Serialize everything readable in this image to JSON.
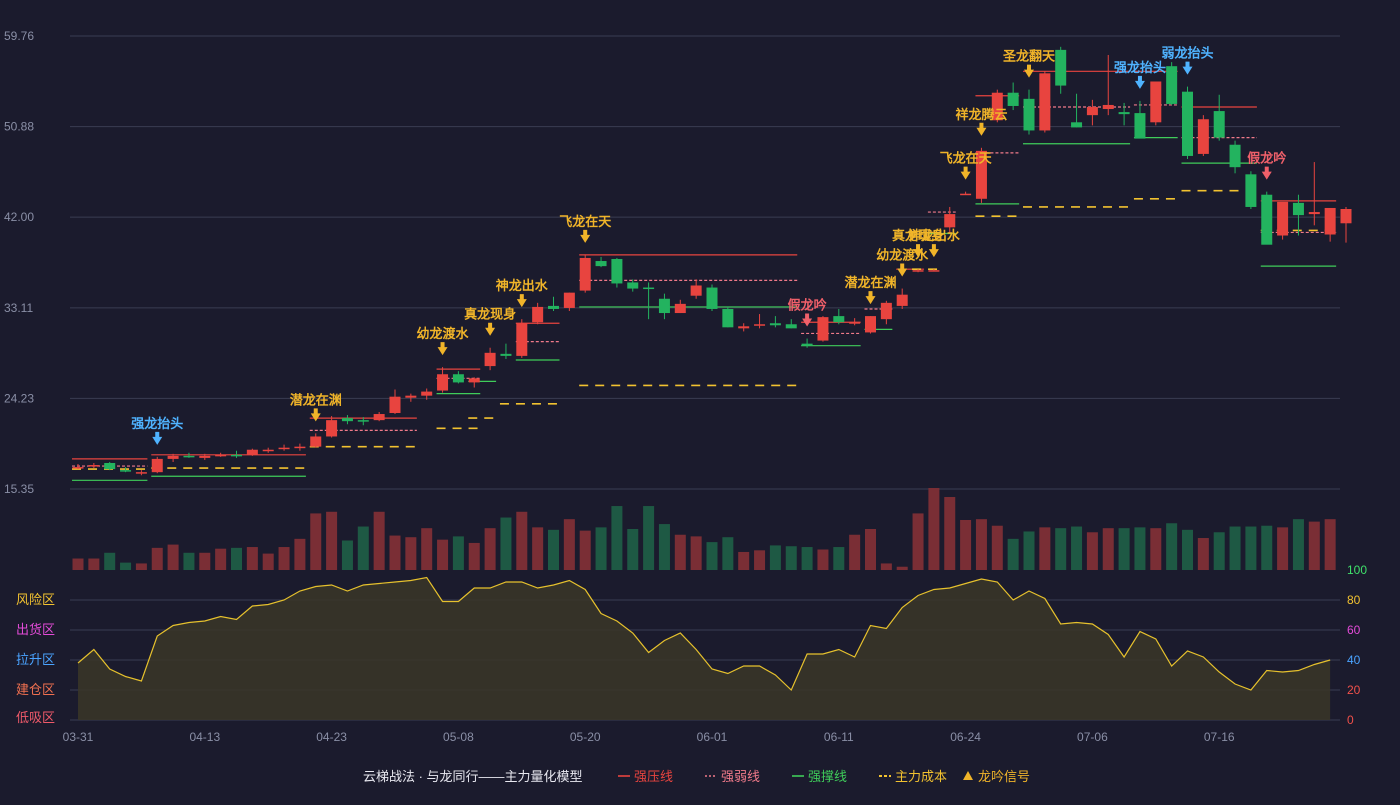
{
  "colors": {
    "up": "#e8443f",
    "down": "#23b35f",
    "vol_up": "#7a2e35",
    "vol_down": "#1e5944",
    "strong_press": "#e8443f",
    "strong_weak": "#f07a8a",
    "strong_support": "#3fcc5a",
    "cost": "#f2c230",
    "signal": "#f0b429",
    "signal_blue": "#4fb3ff",
    "signal_red": "#f0606a",
    "osc_line": "#e6c12d",
    "osc_fill": "#3a3628"
  },
  "chart_data": {
    "type": "candlestick",
    "x_ticks": [
      "03-31",
      "04-13",
      "04-23",
      "05-08",
      "05-20",
      "06-01",
      "06-11",
      "06-24",
      "07-06",
      "07-16"
    ],
    "x_tick_index": [
      0,
      8,
      16,
      24,
      32,
      40,
      48,
      56,
      64,
      72
    ],
    "y_ticks": [
      "59.76",
      "50.88",
      "42.00",
      "33.11",
      "24.23",
      "15.35"
    ],
    "ylim": [
      15.35,
      59.76
    ],
    "ohlc": [
      [
        17.4,
        17.8,
        17.3,
        17.5
      ],
      [
        17.6,
        17.9,
        17.4,
        17.7
      ],
      [
        17.9,
        18.0,
        17.2,
        17.3
      ],
      [
        17.2,
        17.5,
        17.0,
        17.1
      ],
      [
        16.9,
        17.2,
        16.7,
        17.0
      ],
      [
        17.0,
        18.5,
        16.9,
        18.3
      ],
      [
        18.3,
        18.8,
        18.0,
        18.6
      ],
      [
        18.6,
        18.9,
        18.4,
        18.5
      ],
      [
        18.4,
        18.8,
        18.2,
        18.6
      ],
      [
        18.6,
        18.9,
        18.5,
        18.7
      ],
      [
        18.7,
        19.1,
        18.4,
        18.6
      ],
      [
        18.7,
        19.3,
        18.6,
        19.2
      ],
      [
        19.1,
        19.4,
        18.9,
        19.2
      ],
      [
        19.3,
        19.7,
        19.1,
        19.4
      ],
      [
        19.5,
        19.8,
        19.1,
        19.5
      ],
      [
        19.5,
        20.8,
        19.4,
        20.5
      ],
      [
        20.5,
        22.5,
        20.4,
        22.1
      ],
      [
        22.3,
        22.6,
        21.7,
        22.0
      ],
      [
        22.1,
        22.4,
        21.6,
        22.0
      ],
      [
        22.1,
        22.9,
        22.0,
        22.7
      ],
      [
        22.8,
        25.1,
        22.7,
        24.4
      ],
      [
        24.3,
        24.7,
        23.9,
        24.5
      ],
      [
        24.5,
        25.2,
        24.1,
        24.9
      ],
      [
        25.0,
        27.3,
        24.8,
        26.6
      ],
      [
        26.6,
        26.9,
        25.7,
        25.8
      ],
      [
        25.8,
        26.3,
        25.3,
        26.2
      ],
      [
        27.4,
        29.2,
        27.0,
        28.7
      ],
      [
        28.6,
        29.6,
        28.1,
        28.4
      ],
      [
        28.4,
        32.0,
        28.2,
        31.6
      ],
      [
        31.7,
        33.6,
        31.5,
        33.2
      ],
      [
        33.3,
        34.2,
        32.8,
        33.0
      ],
      [
        33.1,
        34.6,
        32.8,
        34.6
      ],
      [
        34.8,
        38.3,
        34.6,
        38.0
      ],
      [
        37.7,
        38.1,
        37.1,
        37.2
      ],
      [
        37.9,
        38.0,
        35.1,
        35.5
      ],
      [
        35.6,
        35.9,
        34.7,
        35.0
      ],
      [
        35.1,
        35.6,
        32.0,
        35.0
      ],
      [
        34.0,
        34.5,
        32.0,
        32.6
      ],
      [
        32.6,
        33.9,
        32.6,
        33.5
      ],
      [
        34.3,
        35.9,
        34.0,
        35.3
      ],
      [
        35.1,
        35.4,
        32.8,
        33.0
      ],
      [
        33.0,
        33.2,
        31.2,
        31.2
      ],
      [
        31.1,
        31.6,
        30.8,
        31.3
      ],
      [
        31.5,
        32.5,
        31.1,
        31.5
      ],
      [
        31.6,
        32.3,
        31.2,
        31.4
      ],
      [
        31.5,
        32.0,
        31.1,
        31.1
      ],
      [
        29.6,
        30.1,
        29.2,
        29.4
      ],
      [
        29.9,
        32.3,
        29.8,
        32.2
      ],
      [
        32.3,
        33.0,
        31.5,
        31.7
      ],
      [
        31.6,
        32.1,
        31.4,
        31.7
      ],
      [
        30.7,
        32.3,
        30.6,
        32.3
      ],
      [
        32.0,
        33.8,
        31.5,
        33.6
      ],
      [
        33.3,
        35.0,
        33.0,
        34.4
      ],
      [
        36.7,
        36.9,
        36.6,
        36.8
      ],
      [
        36.8,
        36.9,
        36.7,
        36.8
      ],
      [
        41.0,
        43.0,
        40.5,
        42.3
      ],
      [
        44.3,
        44.5,
        44.2,
        44.3
      ],
      [
        43.8,
        48.8,
        43.4,
        48.5
      ],
      [
        51.5,
        54.5,
        51.3,
        54.2
      ],
      [
        54.2,
        55.2,
        52.5,
        52.9
      ],
      [
        53.6,
        54.5,
        50.1,
        50.5
      ],
      [
        50.5,
        56.3,
        50.3,
        56.1
      ],
      [
        58.4,
        58.7,
        54.1,
        54.9
      ],
      [
        51.3,
        54.1,
        50.8,
        50.8
      ],
      [
        52.0,
        53.5,
        51.0,
        52.8
      ],
      [
        52.6,
        57.9,
        52.0,
        53.0
      ],
      [
        52.3,
        53.2,
        51.0,
        52.1
      ],
      [
        52.2,
        53.4,
        49.8,
        49.7
      ],
      [
        51.3,
        55.0,
        51.0,
        55.3
      ],
      [
        56.8,
        57.2,
        53.0,
        53.1
      ],
      [
        54.3,
        54.8,
        47.7,
        48.0
      ],
      [
        48.2,
        52.0,
        48.0,
        51.6
      ],
      [
        52.4,
        54.0,
        49.5,
        49.8
      ],
      [
        49.1,
        49.5,
        46.3,
        46.9
      ],
      [
        46.2,
        46.5,
        42.8,
        43.0
      ],
      [
        44.2,
        44.5,
        39.4,
        39.3
      ],
      [
        40.2,
        43.4,
        39.8,
        43.5
      ],
      [
        43.4,
        44.2,
        40.2,
        42.2
      ],
      [
        42.3,
        47.4,
        41.2,
        42.5
      ],
      [
        40.3,
        42.9,
        39.6,
        42.9
      ],
      [
        41.4,
        43.0,
        39.5,
        42.8
      ]
    ],
    "volume_pct": [
      14,
      14,
      21,
      9,
      8,
      27,
      31,
      21,
      21,
      26,
      27,
      28,
      20,
      28,
      38,
      69,
      71,
      36,
      53,
      71,
      42,
      40,
      51,
      37,
      41,
      33,
      51,
      64,
      71,
      52,
      49,
      62,
      48,
      52,
      78,
      50,
      78,
      56,
      43,
      41,
      34,
      40,
      22,
      24,
      30,
      29,
      28,
      25,
      28,
      43,
      50,
      8,
      4,
      69,
      100,
      89,
      61,
      62,
      54,
      38,
      47,
      52,
      51,
      53,
      46,
      51,
      51,
      52,
      51,
      57,
      49,
      39,
      46,
      53,
      53,
      54,
      52,
      62,
      59,
      62
    ],
    "oscillator": [
      38,
      47,
      34,
      29,
      26,
      56,
      63,
      65,
      66,
      69,
      67,
      76,
      77,
      80,
      86,
      89,
      90,
      86,
      90,
      91,
      92,
      93,
      95,
      79,
      79,
      88,
      88,
      92,
      92,
      88,
      90,
      93,
      87,
      71,
      66,
      58,
      45,
      53,
      58,
      47,
      34,
      31,
      36,
      36,
      30,
      20,
      44,
      44,
      47,
      42,
      63,
      61,
      75,
      83,
      87,
      88,
      91,
      94,
      92,
      80,
      86,
      81,
      64,
      65,
      64,
      57,
      42,
      59,
      54,
      36,
      46,
      42,
      32,
      24,
      20,
      33,
      32,
      33,
      37,
      40
    ],
    "osc_ylim": [
      0,
      100
    ],
    "osc_ticks": [
      "100",
      "80",
      "60",
      "40",
      "20",
      "0"
    ],
    "osc_zones": [
      {
        "label": "风险区",
        "color": "#f2c230"
      },
      {
        "label": "出货区",
        "color": "#e34bd8"
      },
      {
        "label": "拉升区",
        "color": "#4aa3ff"
      },
      {
        "label": "建仓区",
        "color": "#f07050"
      },
      {
        "label": "低吸区",
        "color": "#f05a6a"
      }
    ],
    "lines": [
      {
        "kind": "press",
        "from": 0,
        "to": 4,
        "y": 18.3
      },
      {
        "kind": "weak",
        "from": 0,
        "to": 4,
        "y": 17.6
      },
      {
        "kind": "support",
        "from": 0,
        "to": 4,
        "y": 16.2
      },
      {
        "kind": "cost",
        "from": 0,
        "to": 4,
        "y": 17.3
      },
      {
        "kind": "press",
        "from": 5,
        "to": 14,
        "y": 18.7
      },
      {
        "kind": "support",
        "from": 5,
        "to": 14,
        "y": 16.6
      },
      {
        "kind": "cost",
        "from": 5,
        "to": 14,
        "y": 17.4
      },
      {
        "kind": "press",
        "from": 15,
        "to": 21,
        "y": 22.3
      },
      {
        "kind": "weak",
        "from": 15,
        "to": 21,
        "y": 21.1
      },
      {
        "kind": "cost",
        "from": 15,
        "to": 21,
        "y": 19.5
      },
      {
        "kind": "press",
        "from": 23,
        "to": 25,
        "y": 27.1
      },
      {
        "kind": "weak",
        "from": 23,
        "to": 25,
        "y": 26.2
      },
      {
        "kind": "support",
        "from": 23,
        "to": 25,
        "y": 24.7
      },
      {
        "kind": "cost",
        "from": 23,
        "to": 25,
        "y": 21.3
      },
      {
        "kind": "support",
        "from": 25,
        "to": 26,
        "y": 25.9
      },
      {
        "kind": "cost",
        "from": 25,
        "to": 26,
        "y": 22.3
      },
      {
        "kind": "press",
        "from": 28,
        "to": 30,
        "y": 31.6
      },
      {
        "kind": "weak",
        "from": 28,
        "to": 30,
        "y": 29.8
      },
      {
        "kind": "support",
        "from": 28,
        "to": 30,
        "y": 28.0
      },
      {
        "kind": "cost",
        "from": 27,
        "to": 30,
        "y": 23.7
      },
      {
        "kind": "press",
        "from": 32,
        "to": 45,
        "y": 38.3
      },
      {
        "kind": "weak",
        "from": 32,
        "to": 45,
        "y": 35.8
      },
      {
        "kind": "support",
        "from": 32,
        "to": 45,
        "y": 33.2
      },
      {
        "kind": "cost",
        "from": 32,
        "to": 45,
        "y": 25.5
      },
      {
        "kind": "press",
        "from": 46,
        "to": 49,
        "y": 31.7
      },
      {
        "kind": "weak",
        "from": 46,
        "to": 49,
        "y": 30.6
      },
      {
        "kind": "support",
        "from": 46,
        "to": 49,
        "y": 29.4
      },
      {
        "kind": "weak",
        "from": 50,
        "to": 51,
        "y": 33.0
      },
      {
        "kind": "support",
        "from": 50,
        "to": 51,
        "y": 31.0
      },
      {
        "kind": "press",
        "from": 52,
        "to": 53,
        "y": 36.9
      },
      {
        "kind": "cost",
        "from": 53,
        "to": 54,
        "y": 36.9
      },
      {
        "kind": "weak",
        "from": 54,
        "to": 55,
        "y": 42.5
      },
      {
        "kind": "support",
        "from": 54,
        "to": 55,
        "y": 40.4
      },
      {
        "kind": "press",
        "from": 57,
        "to": 59,
        "y": 53.9
      },
      {
        "kind": "weak",
        "from": 57,
        "to": 59,
        "y": 48.3
      },
      {
        "kind": "support",
        "from": 57,
        "to": 59,
        "y": 43.3
      },
      {
        "kind": "cost",
        "from": 57,
        "to": 59,
        "y": 42.1
      },
      {
        "kind": "press",
        "from": 60,
        "to": 66,
        "y": 56.3
      },
      {
        "kind": "weak",
        "from": 60,
        "to": 66,
        "y": 52.8
      },
      {
        "kind": "support",
        "from": 60,
        "to": 66,
        "y": 49.2
      },
      {
        "kind": "cost",
        "from": 60,
        "to": 66,
        "y": 43.0
      },
      {
        "kind": "press",
        "from": 67,
        "to": 69,
        "y": 56.3
      },
      {
        "kind": "weak",
        "from": 67,
        "to": 69,
        "y": 53.0
      },
      {
        "kind": "support",
        "from": 67,
        "to": 69,
        "y": 49.8
      },
      {
        "kind": "cost",
        "from": 67,
        "to": 69,
        "y": 43.8
      },
      {
        "kind": "press",
        "from": 70,
        "to": 74,
        "y": 52.8
      },
      {
        "kind": "weak",
        "from": 70,
        "to": 74,
        "y": 49.8
      },
      {
        "kind": "support",
        "from": 70,
        "to": 74,
        "y": 47.3
      },
      {
        "kind": "cost",
        "from": 70,
        "to": 73,
        "y": 44.6
      },
      {
        "kind": "press",
        "from": 75,
        "to": 79,
        "y": 43.6
      },
      {
        "kind": "weak",
        "from": 75,
        "to": 79,
        "y": 40.5
      },
      {
        "kind": "support",
        "from": 75,
        "to": 79,
        "y": 37.2
      },
      {
        "kind": "cost",
        "from": 75,
        "to": 79,
        "y": 40.7
      }
    ],
    "signals": [
      {
        "index": 5,
        "label": "强龙抬头",
        "type": "blue"
      },
      {
        "index": 15,
        "label": "潜龙在渊",
        "type": "gold"
      },
      {
        "index": 23,
        "label": "幼龙渡水",
        "type": "gold"
      },
      {
        "index": 26,
        "label": "真龙现身",
        "type": "gold"
      },
      {
        "index": 28,
        "label": "神龙出水",
        "type": "gold"
      },
      {
        "index": 32,
        "label": "飞龙在天",
        "type": "gold"
      },
      {
        "index": 46,
        "label": "假龙吟",
        "type": "red"
      },
      {
        "index": 50,
        "label": "潜龙在渊",
        "type": "gold"
      },
      {
        "index": 52,
        "label": "幼龙渡水",
        "type": "gold"
      },
      {
        "index": 53,
        "label": "真龙现身",
        "type": "gold"
      },
      {
        "index": 54,
        "label": "神龙出水",
        "type": "gold"
      },
      {
        "index": 56,
        "label": "飞龙在天",
        "type": "gold"
      },
      {
        "index": 57,
        "label": "祥龙腾云",
        "type": "gold"
      },
      {
        "index": 60,
        "label": "圣龙翻天",
        "type": "gold"
      },
      {
        "index": 67,
        "label": "强龙抬头",
        "type": "blue"
      },
      {
        "index": 70,
        "label": "弱龙抬头",
        "type": "blue"
      },
      {
        "index": 75,
        "label": "假龙吟",
        "type": "red"
      }
    ]
  },
  "legend": {
    "title": "云梯战法 · 与龙同行——主力量化模型",
    "items": [
      {
        "label": "强压线",
        "kind": "press",
        "color": "#e8443f"
      },
      {
        "label": "强弱线",
        "kind": "weak",
        "color": "#f07a8a"
      },
      {
        "label": "强撑线",
        "kind": "support",
        "color": "#3fcc5a"
      },
      {
        "label": "主力成本",
        "kind": "cost",
        "color": "#f2c230"
      },
      {
        "label": "龙吟信号",
        "kind": "signal",
        "color": "#f0b429"
      }
    ]
  }
}
